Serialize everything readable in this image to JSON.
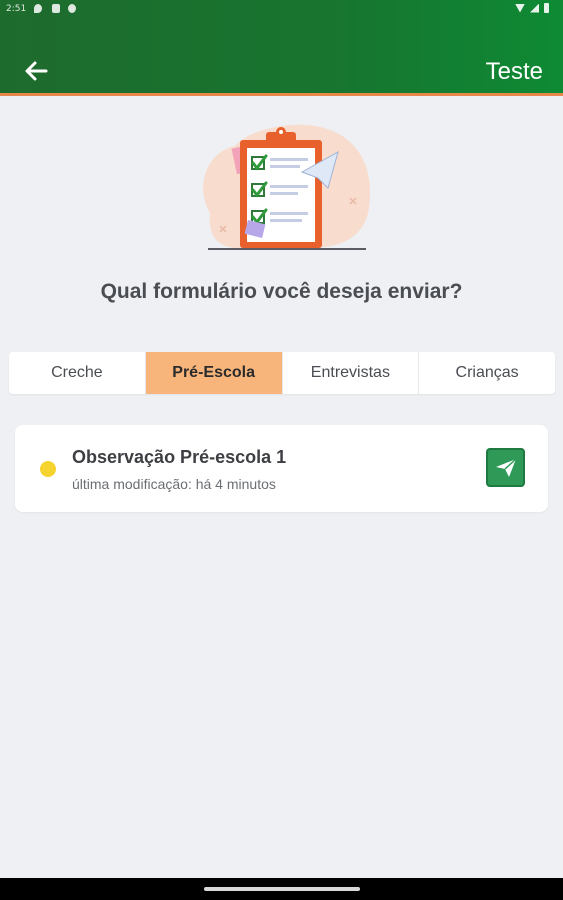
{
  "status_bar": {
    "time": "2:51",
    "icons": [
      "location-icon",
      "clipboard-icon",
      "gear-icon"
    ],
    "right_icons": [
      "wifi-icon",
      "signal-icon",
      "battery-icon"
    ]
  },
  "header": {
    "title": "Teste",
    "back_icon": "arrow-left-icon",
    "accent_color": "#e8874a",
    "background_colors": [
      "#1e6b2e",
      "#0e8a34"
    ]
  },
  "illustration": {
    "icon": "clipboard-checklist-icon"
  },
  "question": "Qual formulário você deseja enviar?",
  "tabs": [
    {
      "label": "Creche",
      "active": false
    },
    {
      "label": "Pré-Escola",
      "active": true
    },
    {
      "label": "Entrevistas",
      "active": false
    },
    {
      "label": "Crianças",
      "active": false
    }
  ],
  "active_tab_color": "#f7b57c",
  "forms": [
    {
      "title": "Observação Pré-escola 1",
      "subtitle": "última modificação: há 4 minutos",
      "status_color": "#f7d330",
      "action_icon": "send-icon",
      "action_color": "#2f9a57"
    }
  ]
}
